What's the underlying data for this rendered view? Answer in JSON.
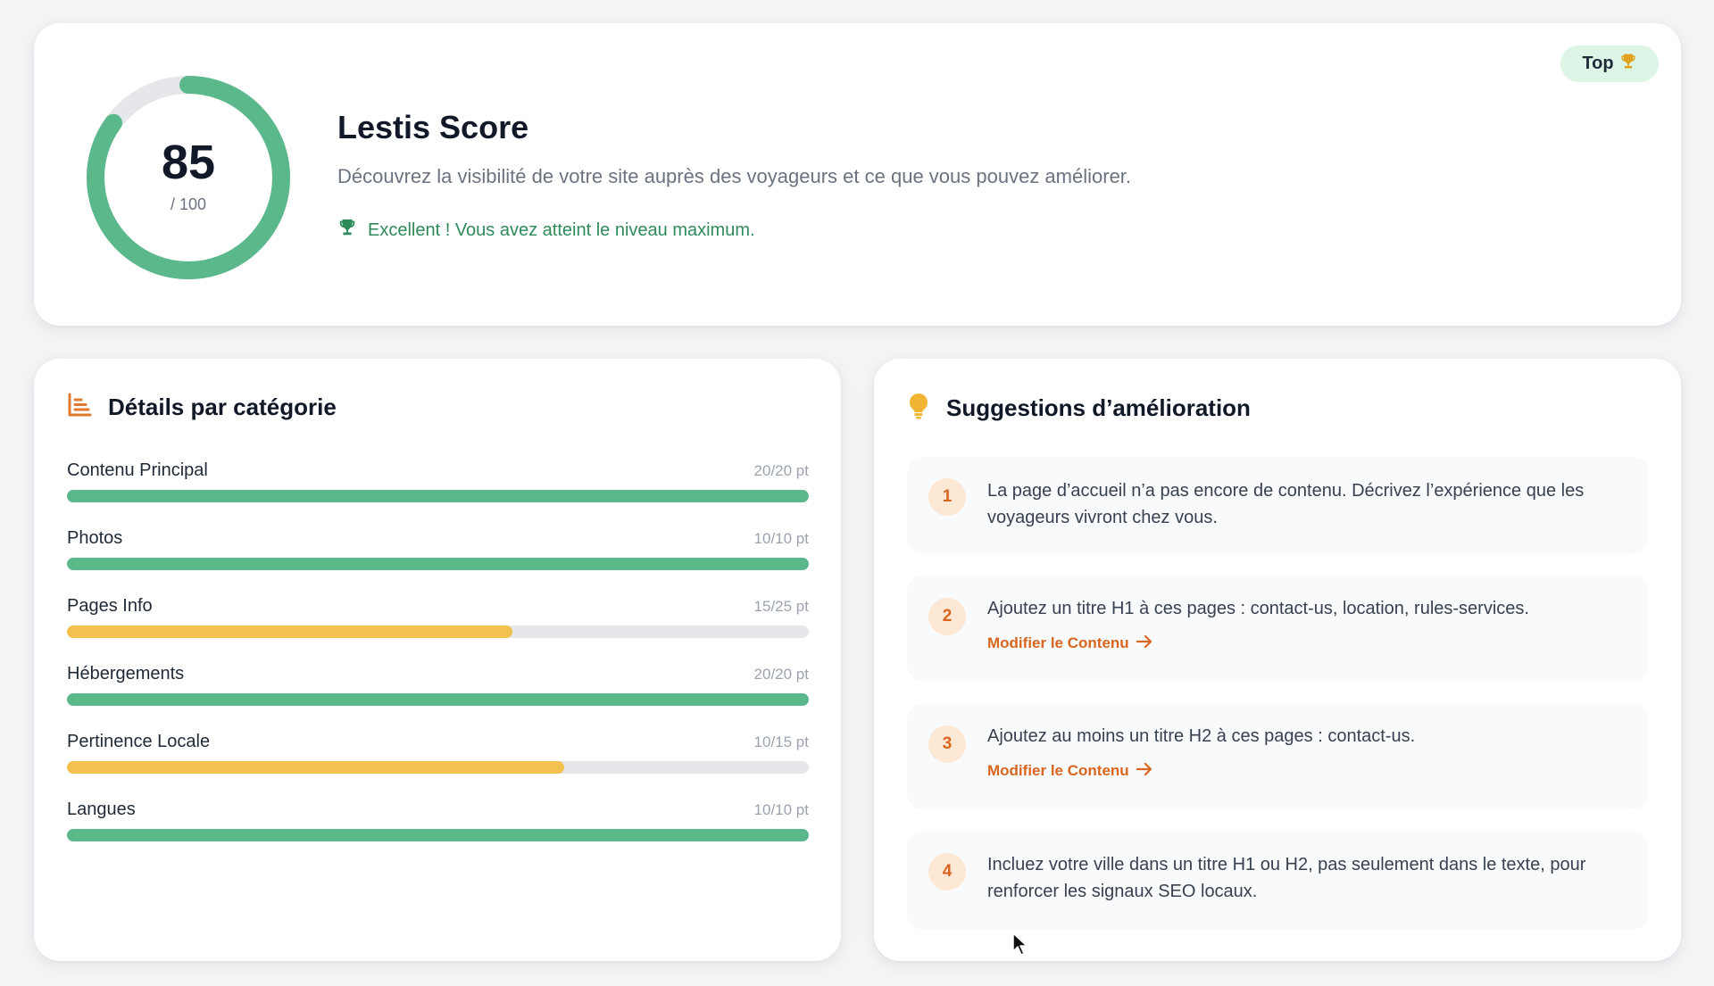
{
  "score": {
    "value": "85",
    "max_label": "/ 100",
    "fraction": 0.85,
    "title": "Lestis Score",
    "subtitle": "Découvrez la visibilité de votre site auprès des voyageurs et ce que vous pouvez améliorer.",
    "status": "Excellent ! Vous avez atteint le niveau maximum.",
    "badge_label": "Top",
    "badge_icon": "trophy-icon"
  },
  "details": {
    "title": "Détails par catégorie",
    "icon": "bar-chart-icon",
    "categories": [
      {
        "name": "Contenu Principal",
        "points": "20/20 pt",
        "fraction": 1.0,
        "status": "complete"
      },
      {
        "name": "Photos",
        "points": "10/10 pt",
        "fraction": 1.0,
        "status": "complete"
      },
      {
        "name": "Pages Info",
        "points": "15/25 pt",
        "fraction": 0.6,
        "status": "partial"
      },
      {
        "name": "Hébergements",
        "points": "20/20 pt",
        "fraction": 1.0,
        "status": "complete"
      },
      {
        "name": "Pertinence Locale",
        "points": "10/15 pt",
        "fraction": 0.67,
        "status": "partial"
      },
      {
        "name": "Langues",
        "points": "10/10 pt",
        "fraction": 1.0,
        "status": "complete"
      }
    ]
  },
  "suggestions": {
    "title": "Suggestions d’amélioration",
    "icon": "lightbulb-icon",
    "items": [
      {
        "number": "1",
        "text": "La page d’accueil n’a pas encore de contenu. Décrivez l’expérience que les voyageurs vivront chez vous.",
        "link": ""
      },
      {
        "number": "2",
        "text": "Ajoutez un titre H1 à ces pages : contact-us, location, rules-services.",
        "link": "Modifier le Contenu"
      },
      {
        "number": "3",
        "text": "Ajoutez au moins un titre H2 à ces pages : contact-us.",
        "link": "Modifier le Contenu"
      },
      {
        "number": "4",
        "text": "Incluez votre ville dans un titre H1 ou H2, pas seulement dans le texte, pour renforcer les signaux SEO locaux.",
        "link": ""
      }
    ]
  },
  "colors": {
    "accent_green": "#5bb88a",
    "accent_yellow": "#f2c14e",
    "accent_orange": "#e07a2e",
    "track": "#e5e7eb",
    "success_text": "#2f8a5a"
  }
}
